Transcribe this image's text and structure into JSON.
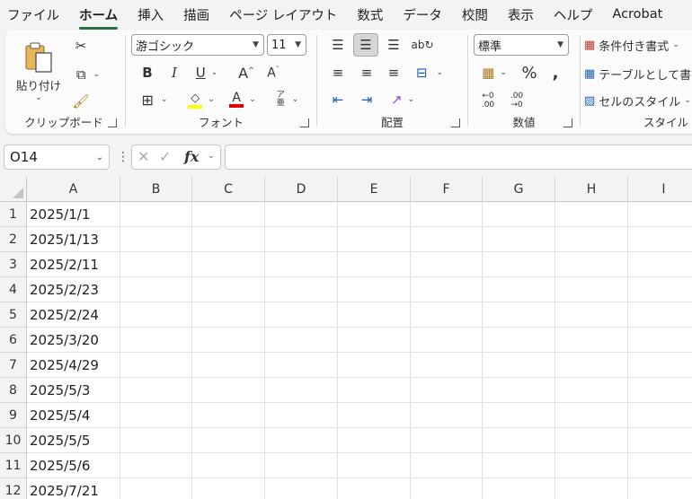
{
  "menu": {
    "tabs": [
      {
        "label": "ファイル",
        "active": false
      },
      {
        "label": "ホーム",
        "active": true
      },
      {
        "label": "挿入",
        "active": false
      },
      {
        "label": "描画",
        "active": false
      },
      {
        "label": "ページ レイアウト",
        "active": false
      },
      {
        "label": "数式",
        "active": false
      },
      {
        "label": "データ",
        "active": false
      },
      {
        "label": "校閲",
        "active": false
      },
      {
        "label": "表示",
        "active": false
      },
      {
        "label": "ヘルプ",
        "active": false
      },
      {
        "label": "Acrobat",
        "active": false
      }
    ]
  },
  "ribbon": {
    "clipboard": {
      "label": "クリップボード",
      "paste_label": "貼り付け"
    },
    "font": {
      "label": "フォント",
      "font_name": "游ゴシック",
      "font_size": "11"
    },
    "alignment": {
      "label": "配置"
    },
    "number": {
      "label": "数値",
      "format": "標準"
    },
    "styles": {
      "label": "スタイル",
      "conditional": "条件付き書式",
      "table": "テーブルとして書式",
      "cell_styles": "セルのスタイル"
    }
  },
  "formula_bar": {
    "name_box": "O14",
    "formula": ""
  },
  "sheet": {
    "columns": [
      "A",
      "B",
      "C",
      "D",
      "E",
      "F",
      "G",
      "H",
      "I"
    ],
    "rows": [
      {
        "n": "1",
        "a": "2025/1/1"
      },
      {
        "n": "2",
        "a": "2025/1/13"
      },
      {
        "n": "3",
        "a": "2025/2/11"
      },
      {
        "n": "4",
        "a": "2025/2/23"
      },
      {
        "n": "5",
        "a": "2025/2/24"
      },
      {
        "n": "6",
        "a": "2025/3/20"
      },
      {
        "n": "7",
        "a": "2025/4/29"
      },
      {
        "n": "8",
        "a": "2025/5/3"
      },
      {
        "n": "9",
        "a": "2025/5/4"
      },
      {
        "n": "10",
        "a": "2025/5/5"
      },
      {
        "n": "11",
        "a": "2025/5/6"
      },
      {
        "n": "12",
        "a": "2025/7/21"
      }
    ]
  },
  "colors": {
    "accent": "#217346",
    "fill_highlight": "#ffff00",
    "font_red": "#e00000"
  }
}
